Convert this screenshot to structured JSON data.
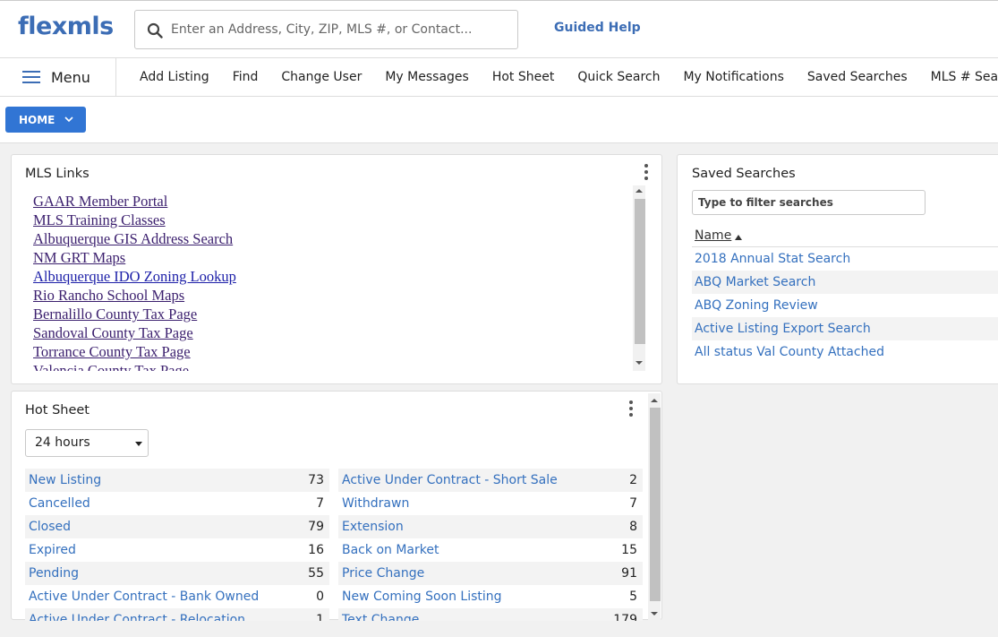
{
  "header": {
    "logo": "flexmls",
    "search_placeholder": "Enter an Address, City, ZIP, MLS #, or Contact...",
    "guided_help": "Guided Help"
  },
  "nav": {
    "menu_label": "Menu",
    "items": [
      "Add Listing",
      "Find",
      "Change User",
      "My Messages",
      "Hot Sheet",
      "Quick Search",
      "My Notifications",
      "Saved Searches",
      "MLS # Search"
    ]
  },
  "home_button": "HOME",
  "mls_links": {
    "title": "MLS Links",
    "links": [
      "GAAR Member Portal",
      "MLS Training Classes",
      "Albuquerque GIS Address Search",
      "NM GRT Maps",
      "Albuquerque IDO Zoning Lookup",
      "Rio Rancho School Maps",
      "Bernalillo County Tax Page",
      "Sandoval County Tax Page",
      "Torrance County Tax Page",
      "Valencia County Tax Page"
    ]
  },
  "saved_searches": {
    "title": "Saved Searches",
    "filter_placeholder": "Type to filter searches",
    "column_name": "Name",
    "items": [
      "2018 Annual Stat Search",
      "ABQ Market Search",
      "ABQ Zoning Review",
      "Active Listing Export Search",
      "All status Val County Attached"
    ]
  },
  "hot_sheet": {
    "title": "Hot Sheet",
    "period": "24 hours",
    "left": [
      {
        "label": "New Listing",
        "count": "73"
      },
      {
        "label": "Cancelled",
        "count": "7"
      },
      {
        "label": "Closed",
        "count": "79"
      },
      {
        "label": "Expired",
        "count": "16"
      },
      {
        "label": "Pending",
        "count": "55"
      },
      {
        "label": "Active Under Contract - Bank Owned",
        "count": "0"
      },
      {
        "label": "Active Under Contract - Relocation",
        "count": "1"
      }
    ],
    "right": [
      {
        "label": "Active Under Contract - Short Sale",
        "count": "2"
      },
      {
        "label": "Withdrawn",
        "count": "7"
      },
      {
        "label": "Extension",
        "count": "8"
      },
      {
        "label": "Back on Market",
        "count": "15"
      },
      {
        "label": "Price Change",
        "count": "91"
      },
      {
        "label": "New Coming Soon Listing",
        "count": "5"
      },
      {
        "label": "Text Change",
        "count": "179"
      }
    ]
  }
}
